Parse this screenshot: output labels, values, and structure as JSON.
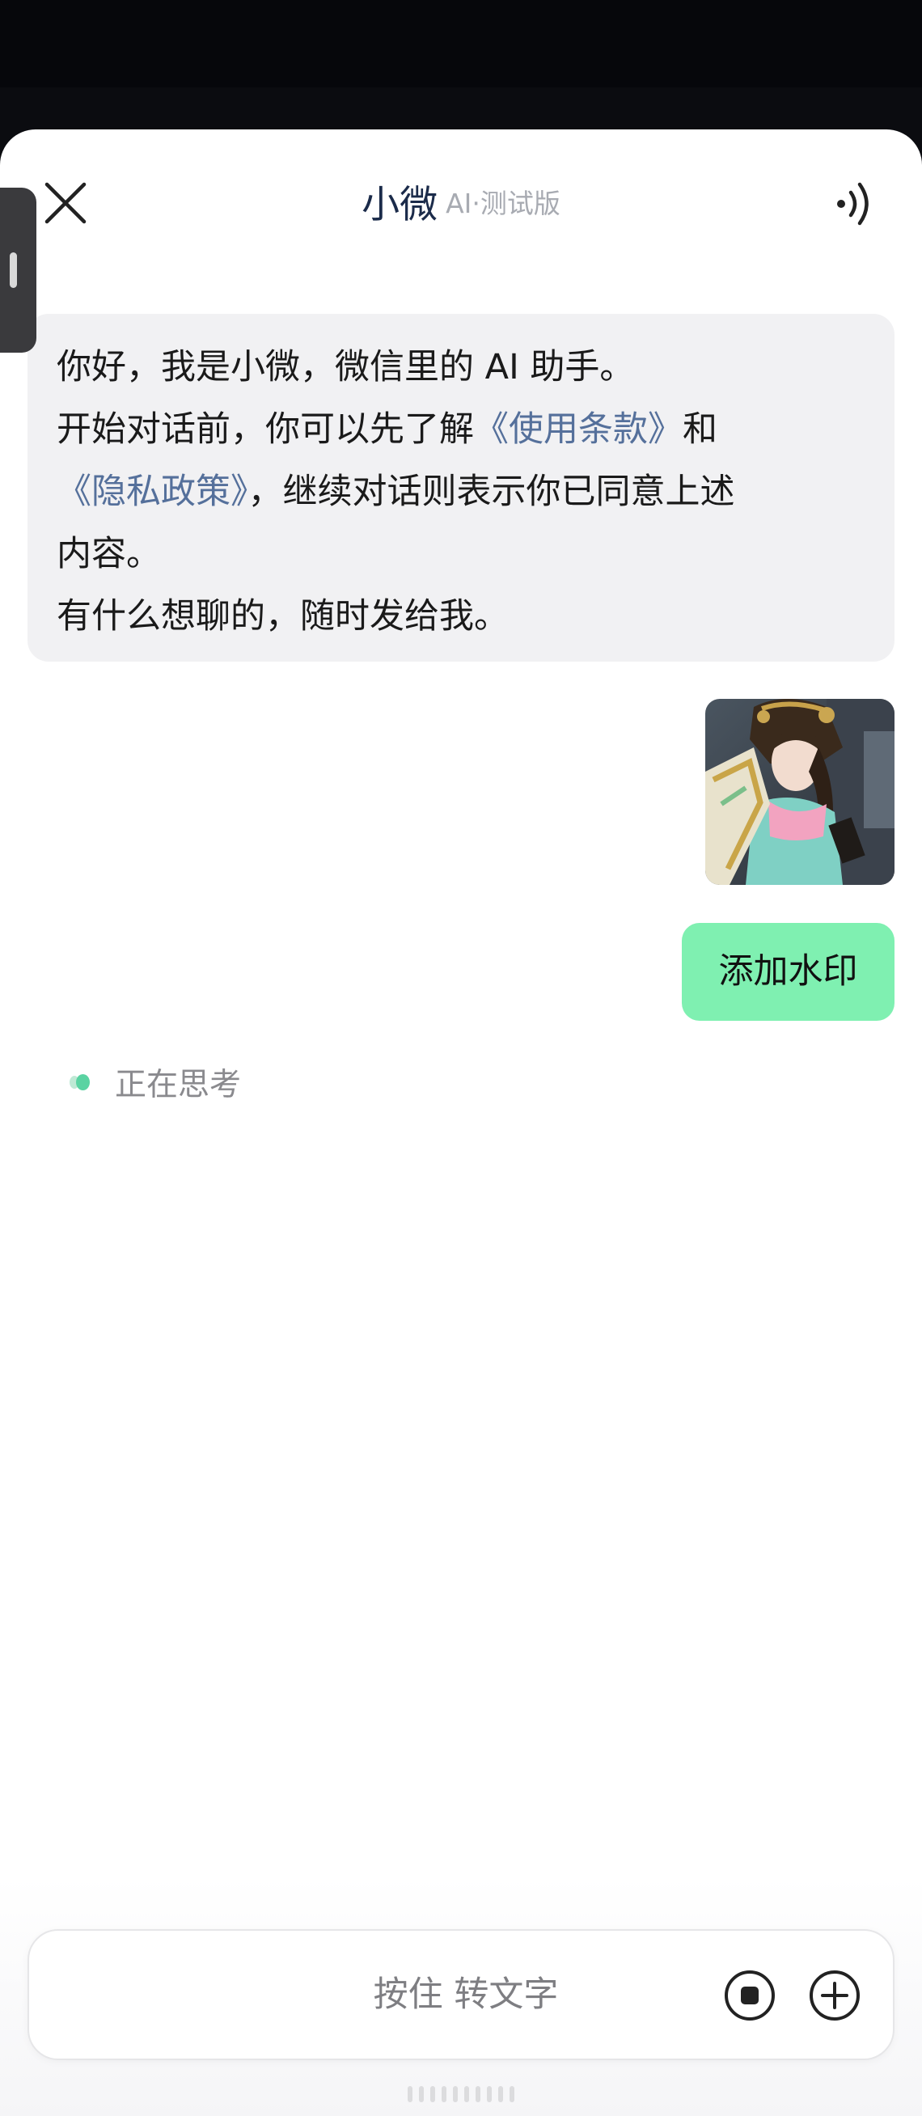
{
  "header": {
    "title": "小微",
    "subtitle": "AI·测试版",
    "close_icon": "close-icon",
    "speaker_icon": "speaker-icon"
  },
  "messages": {
    "bot_intro": {
      "line1": "你好，我是小微，微信里的 AI 助手。",
      "line2_prefix": "开始对话前，你可以先了解",
      "terms_link": "《使用条款》",
      "line2_suffix": "和",
      "privacy_link": "《隐私政策》",
      "line3_suffix": "，继续对话则表示你已同意上述",
      "line4": "内容。",
      "line5": "有什么想聊的，随时发给我。"
    },
    "user_image": {
      "description_icon": "photo-thumbnail"
    },
    "user_text": "添加水印",
    "status": "正在思考"
  },
  "input": {
    "hold_to_talk": "按住 转文字",
    "stop_icon": "stop-icon",
    "add_icon": "plus-circle-icon"
  },
  "colors": {
    "accent_green": "#7ff0b1",
    "link": "#55709b",
    "title": "#1b2b4a",
    "thinking_dot": "#5ad3a2"
  }
}
